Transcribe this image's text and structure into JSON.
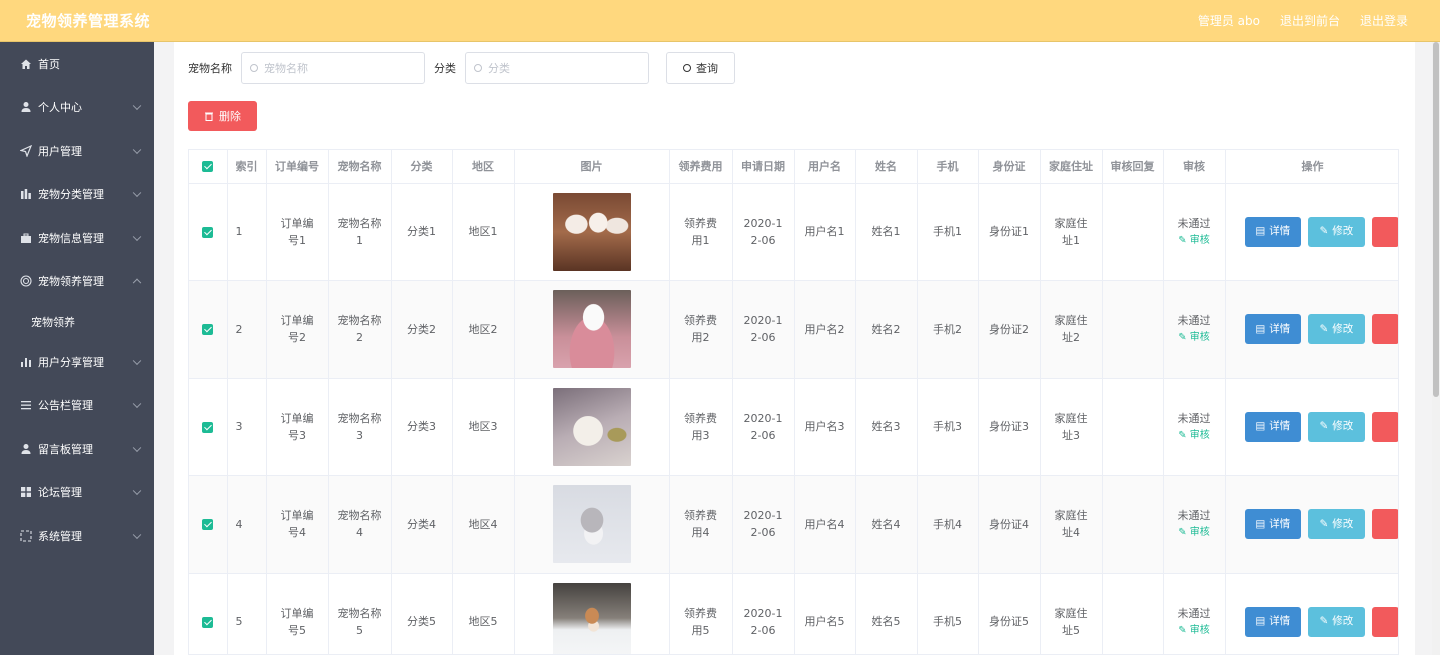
{
  "header": {
    "title": "宠物领养管理系统",
    "admin": "管理员 abo",
    "to_front": "退出到前台",
    "logout": "退出登录"
  },
  "sidebar": {
    "items": [
      {
        "label": "首页",
        "icon": "home-icon",
        "has_chevron": false
      },
      {
        "label": "个人中心",
        "icon": "user-icon",
        "has_chevron": true
      },
      {
        "label": "用户管理",
        "icon": "send-icon",
        "has_chevron": true
      },
      {
        "label": "宠物分类管理",
        "icon": "chart-icon",
        "has_chevron": true
      },
      {
        "label": "宠物信息管理",
        "icon": "briefcase-icon",
        "has_chevron": true
      },
      {
        "label": "宠物领养管理",
        "icon": "circle-icon",
        "has_chevron": true,
        "expanded": true
      },
      {
        "label": "用户分享管理",
        "icon": "bar-chart-icon",
        "has_chevron": true
      },
      {
        "label": "公告栏管理",
        "icon": "list-icon",
        "has_chevron": true
      },
      {
        "label": "留言板管理",
        "icon": "user-icon",
        "has_chevron": true
      },
      {
        "label": "论坛管理",
        "icon": "grid-icon",
        "has_chevron": true
      },
      {
        "label": "系统管理",
        "icon": "dashed-square-icon",
        "has_chevron": true
      }
    ],
    "sub_item": "宠物领养"
  },
  "search": {
    "name_label": "宠物名称",
    "name_placeholder": "宠物名称",
    "category_label": "分类",
    "category_placeholder": "分类",
    "query_button": "查询"
  },
  "delete_button": "删除",
  "table": {
    "headers": [
      "索引",
      "订单编号",
      "宠物名称",
      "分类",
      "地区",
      "图片",
      "领养费用",
      "申请日期",
      "用户名",
      "姓名",
      "手机",
      "身份证",
      "家庭住址",
      "审核回复",
      "审核",
      "操作"
    ],
    "rows": [
      {
        "index": "1",
        "order": "订单编号1",
        "name": "宠物名称1",
        "category": "分类1",
        "region": "地区1",
        "fee": "领养费用1",
        "date": "2020-12-06",
        "username": "用户名1",
        "realname": "姓名1",
        "phone": "手机1",
        "idcard": "身份证1",
        "address": "家庭住址1",
        "reply": "",
        "status": "未通过",
        "audit": "审核",
        "picture": "puppies-photo"
      },
      {
        "index": "2",
        "order": "订单编号2",
        "name": "宠物名称2",
        "category": "分类2",
        "region": "地区2",
        "fee": "领养费用2",
        "date": "2020-12-06",
        "username": "用户名2",
        "realname": "姓名2",
        "phone": "手机2",
        "idcard": "身份证2",
        "address": "家庭住址2",
        "reply": "",
        "status": "未通过",
        "audit": "审核",
        "picture": "white-dog-blanket-photo"
      },
      {
        "index": "3",
        "order": "订单编号3",
        "name": "宠物名称3",
        "category": "分类3",
        "region": "地区3",
        "fee": "领养费用3",
        "date": "2020-12-06",
        "username": "用户名3",
        "realname": "姓名3",
        "phone": "手机3",
        "idcard": "身份证3",
        "address": "家庭住址3",
        "reply": "",
        "status": "未通过",
        "audit": "审核",
        "picture": "kitten-photo"
      },
      {
        "index": "4",
        "order": "订单编号4",
        "name": "宠物名称4",
        "category": "分类4",
        "region": "地区4",
        "fee": "领养费用4",
        "date": "2020-12-06",
        "username": "用户名4",
        "realname": "姓名4",
        "phone": "手机4",
        "idcard": "身份证4",
        "address": "家庭住址4",
        "reply": "",
        "status": "未通过",
        "audit": "审核",
        "picture": "rat-photo"
      },
      {
        "index": "5",
        "order": "订单编号5",
        "name": "宠物名称5",
        "category": "分类5",
        "region": "地区5",
        "fee": "领养费用5",
        "date": "2020-12-06",
        "username": "用户名5",
        "realname": "姓名5",
        "phone": "手机5",
        "idcard": "身份证5",
        "address": "家庭住址5",
        "reply": "",
        "status": "未通过",
        "audit": "审核",
        "picture": "shiba-snow-photo"
      }
    ],
    "ops": {
      "detail": "详情",
      "edit": "修改"
    }
  },
  "colors": {
    "header_bg": "#ffd87e",
    "sidebar_bg": "#434958",
    "accent_green": "#1dbb95",
    "danger": "#f25a5c",
    "primary": "#3f8dd3",
    "info": "#5cc0dd"
  }
}
